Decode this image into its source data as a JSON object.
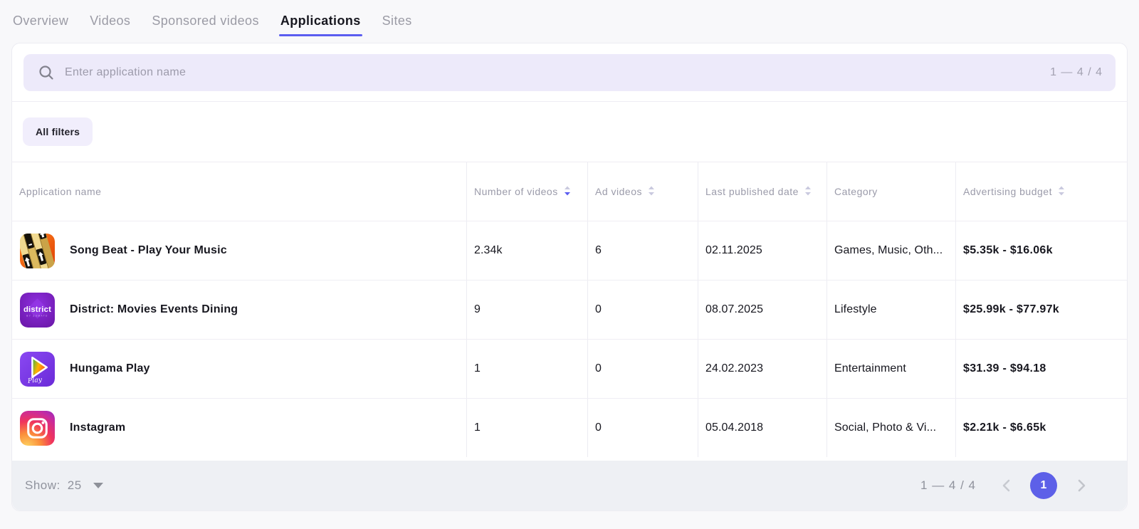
{
  "tabs": [
    {
      "label": "Overview",
      "active": false
    },
    {
      "label": "Videos",
      "active": false
    },
    {
      "label": "Sponsored videos",
      "active": false
    },
    {
      "label": "Applications",
      "active": true
    },
    {
      "label": "Sites",
      "active": false
    }
  ],
  "search": {
    "placeholder": "Enter application name",
    "results_counter": "1 — 4 / 4"
  },
  "filters": {
    "all_filters_label": "All filters"
  },
  "table": {
    "columns": [
      {
        "label": "Application name",
        "sortable": false
      },
      {
        "label": "Number of videos",
        "sortable": true,
        "sort_active": "desc"
      },
      {
        "label": "Ad videos",
        "sortable": true
      },
      {
        "label": "Last published date",
        "sortable": true
      },
      {
        "label": "Category",
        "sortable": false
      },
      {
        "label": "Advertising budget",
        "sortable": true
      }
    ],
    "rows": [
      {
        "icon": "song-beat-app-icon",
        "name": "Song Beat - Play Your Music",
        "videos": "2.34k",
        "ad_videos": "6",
        "last_published": "02.11.2025",
        "category": "Games, Music, Oth...",
        "budget": "$5.35k - $16.06k"
      },
      {
        "icon": "district-app-icon",
        "name": "District: Movies Events Dining",
        "videos": "9",
        "ad_videos": "0",
        "last_published": "08.07.2025",
        "category": "Lifestyle",
        "budget": "$25.99k - $77.97k"
      },
      {
        "icon": "hungama-play-app-icon",
        "name": "Hungama Play",
        "videos": "1",
        "ad_videos": "0",
        "last_published": "24.02.2023",
        "category": "Entertainment",
        "budget": "$31.39 - $94.18"
      },
      {
        "icon": "instagram-app-icon",
        "name": "Instagram",
        "videos": "1",
        "ad_videos": "0",
        "last_published": "05.04.2018",
        "category": "Social, Photo & Vi...",
        "budget": "$2.21k - $6.65k"
      }
    ]
  },
  "footer": {
    "show_label": "Show:",
    "page_size": "25",
    "results_counter": "1 — 4 / 4",
    "current_page": "1"
  },
  "colors": {
    "accent": "#5b5df0",
    "search_bg": "#edeafa",
    "footer_bg": "#eef0f4",
    "pagination_circle": "#5d60e8"
  }
}
